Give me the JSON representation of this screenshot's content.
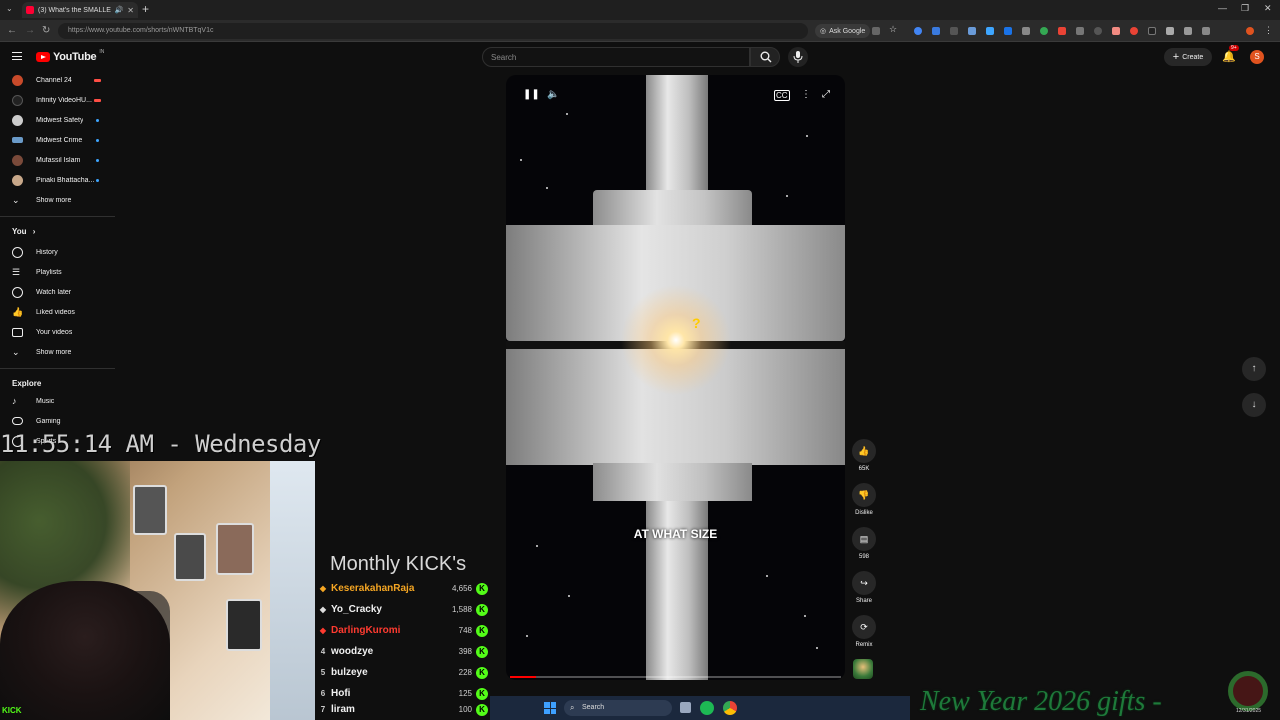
{
  "browser": {
    "tab_title": "(3) What's the SMALLEST B",
    "url": "https://www.youtube.com/shorts/nWNTBTqV1c",
    "ask_google": "Ask Google"
  },
  "header": {
    "logo_text": "YouTube",
    "logo_country": "IN",
    "search_placeholder": "Search",
    "create_label": "Create",
    "notification_count": "9+",
    "avatar_letter": "S"
  },
  "sidebar": {
    "subscriptions": [
      {
        "label": "Channel 24",
        "status": "live",
        "color": "#c84a2a"
      },
      {
        "label": "Infinity VideoHU...",
        "status": "live",
        "color": "#222222"
      },
      {
        "label": "Midwest Safety",
        "status": "new",
        "color": "#cccccc"
      },
      {
        "label": "Midwest Crime",
        "status": "new",
        "color": "#6a9ac8"
      },
      {
        "label": "Mufassil Islam",
        "status": "new",
        "color": "#7a4a3a"
      },
      {
        "label": "Pinaki Bhattacha...",
        "status": "new",
        "color": "#c8a88a"
      }
    ],
    "show_more_1": "Show more",
    "you_header": "You",
    "you_items": [
      {
        "label": "History",
        "icon": "history-icon"
      },
      {
        "label": "Playlists",
        "icon": "playlists-icon"
      },
      {
        "label": "Watch later",
        "icon": "watch-later-icon"
      },
      {
        "label": "Liked videos",
        "icon": "liked-videos-icon"
      },
      {
        "label": "Your videos",
        "icon": "your-videos-icon"
      }
    ],
    "show_more_2": "Show more",
    "explore_header": "Explore",
    "explore_items": [
      {
        "label": "Music",
        "icon": "music-icon"
      },
      {
        "label": "Gaming",
        "icon": "gaming-icon"
      },
      {
        "label": "Sports",
        "icon": "sports-icon"
      }
    ]
  },
  "overlay": {
    "clock": "11:55:14 AM - Wednesday",
    "kicks_title": "Monthly KICK's",
    "kick_tag": "KICK",
    "gifts_banner": "New Year 2026 gifts -",
    "tray_time": "12/31/2025",
    "kicks": [
      {
        "rank": "",
        "name": "KeserakahanRaja",
        "count": "4,656",
        "color": "#f5a623",
        "rank_icon": "gold-diamond"
      },
      {
        "rank": "",
        "name": "Yo_Cracky",
        "count": "1,588",
        "color": "#e8e8e8",
        "rank_icon": "silver-diamond"
      },
      {
        "rank": "",
        "name": "DarlingKuromi",
        "count": "748",
        "color": "#ff3b30",
        "rank_icon": "red-diamond"
      },
      {
        "rank": "4",
        "name": "woodzye",
        "count": "398",
        "color": "#e8e8e8"
      },
      {
        "rank": "5",
        "name": "bulzeye",
        "count": "228",
        "color": "#e8e8e8"
      },
      {
        "rank": "6",
        "name": "Hofi",
        "count": "125",
        "color": "#e8e8e8"
      },
      {
        "rank": "7",
        "name": "liram",
        "count": "100",
        "color": "#e8e8e8"
      }
    ]
  },
  "short": {
    "caption": "AT WHAT SIZE",
    "progress": 0.08,
    "actions": {
      "like_count": "65K",
      "dislike_label": "Dislike",
      "comments_count": "598",
      "share_label": "Share",
      "remix_label": "Remix"
    }
  },
  "taskbar": {
    "search_label": "Search"
  }
}
